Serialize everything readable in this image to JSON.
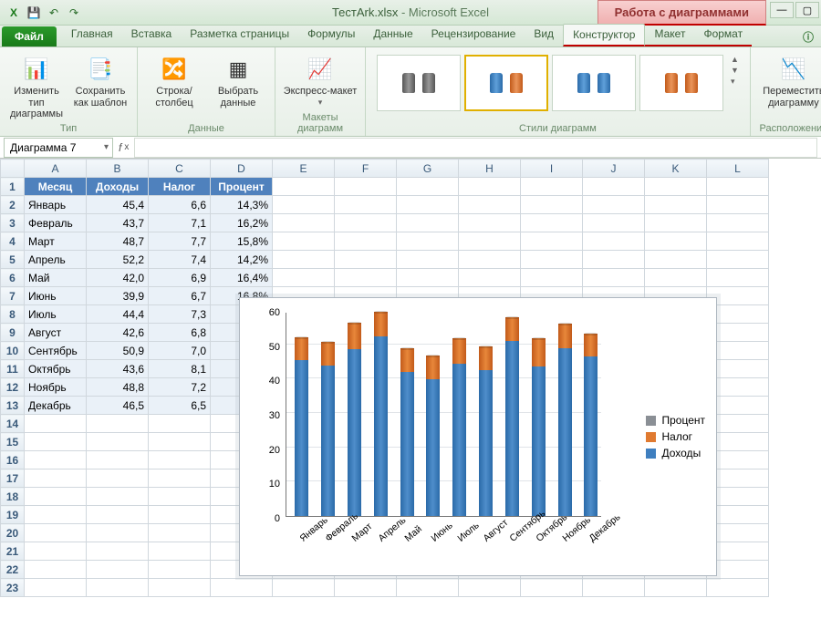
{
  "title": {
    "doc": "ТестArk.xlsx",
    "app": "Microsoft Excel"
  },
  "chart_tools_label": "Работа с диаграммами",
  "tabs": {
    "file": "Файл",
    "items": [
      "Главная",
      "Вставка",
      "Разметка страницы",
      "Формулы",
      "Данные",
      "Рецензирование",
      "Вид",
      "Конструктор",
      "Макет",
      "Формат"
    ],
    "active_index": 7
  },
  "ribbon": {
    "type": {
      "change": "Изменить тип диаграммы",
      "save_tpl": "Сохранить как шаблон",
      "group": "Тип"
    },
    "data": {
      "swap": "Строка/столбец",
      "select": "Выбрать данные",
      "group": "Данные"
    },
    "layouts": {
      "quick": "Экспресс-макет",
      "group": "Макеты диаграмм"
    },
    "styles": {
      "group": "Стили диаграмм"
    },
    "location": {
      "move": "Переместить диаграмму",
      "group": "Расположение"
    }
  },
  "name_box": "Диаграмма 7",
  "columns": [
    "A",
    "B",
    "C",
    "D",
    "E",
    "F",
    "G",
    "H",
    "I",
    "J",
    "K",
    "L"
  ],
  "headers": [
    "Месяц",
    "Доходы",
    "Налог",
    "Процент"
  ],
  "rows": [
    {
      "m": "Январь",
      "i": "45,4",
      "t": "6,6",
      "p": "14,3%"
    },
    {
      "m": "Февраль",
      "i": "43,7",
      "t": "7,1",
      "p": "16,2%"
    },
    {
      "m": "Март",
      "i": "48,7",
      "t": "7,7",
      "p": "15,8%"
    },
    {
      "m": "Апрель",
      "i": "52,2",
      "t": "7,4",
      "p": "14,2%"
    },
    {
      "m": "Май",
      "i": "42,0",
      "t": "6,9",
      "p": "16,4%"
    },
    {
      "m": "Июнь",
      "i": "39,9",
      "t": "6,7",
      "p": "16,8%"
    },
    {
      "m": "Июль",
      "i": "44,4",
      "t": "7,3",
      "p": ""
    },
    {
      "m": "Август",
      "i": "42,6",
      "t": "6,8",
      "p": ""
    },
    {
      "m": "Сентябрь",
      "i": "50,9",
      "t": "7,0",
      "p": ""
    },
    {
      "m": "Октябрь",
      "i": "43,6",
      "t": "8,1",
      "p": ""
    },
    {
      "m": "Ноябрь",
      "i": "48,8",
      "t": "7,2",
      "p": ""
    },
    {
      "m": "Декабрь",
      "i": "46,5",
      "t": "6,5",
      "p": ""
    }
  ],
  "chart_data": {
    "type": "bar",
    "stacked": true,
    "categories": [
      "Январь",
      "Февраль",
      "Март",
      "Апрель",
      "Май",
      "Июнь",
      "Июль",
      "Август",
      "Сентябрь",
      "Октябрь",
      "Ноябрь",
      "Декабрь"
    ],
    "series": [
      {
        "name": "Доходы",
        "color": "#3f7fbf",
        "values": [
          45.4,
          43.7,
          48.7,
          52.2,
          42.0,
          39.9,
          44.4,
          42.6,
          50.9,
          43.6,
          48.8,
          46.5
        ]
      },
      {
        "name": "Налог",
        "color": "#e07a30",
        "values": [
          6.6,
          7.1,
          7.7,
          7.4,
          6.9,
          6.7,
          7.3,
          6.8,
          7.0,
          8.1,
          7.2,
          6.5
        ]
      },
      {
        "name": "Процент",
        "color": "#8a8f95",
        "values": [
          0.143,
          0.162,
          0.158,
          0.142,
          0.164,
          0.168,
          0.164,
          0.16,
          0.137,
          0.186,
          0.148,
          0.14
        ]
      }
    ],
    "ylim": [
      0,
      60
    ],
    "yticks": [
      0,
      10,
      20,
      30,
      40,
      50,
      60
    ],
    "legend": [
      "Процент",
      "Налог",
      "Доходы"
    ],
    "legend_colors": [
      "#8a8f95",
      "#e07a30",
      "#3f7fbf"
    ]
  }
}
